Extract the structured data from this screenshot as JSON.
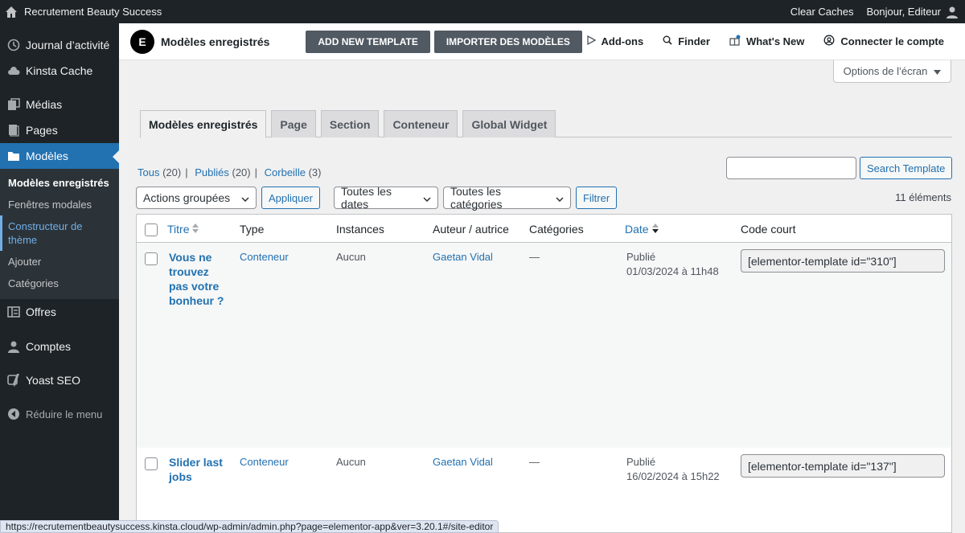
{
  "adminbar": {
    "site_name": "Recrutement Beauty Success",
    "clear_caches": "Clear Caches",
    "greeting": "Bonjour, Editeur"
  },
  "sidebar": {
    "items": [
      {
        "label": "Journal d’activité",
        "icon": "history-icon"
      },
      {
        "label": "Kinsta Cache",
        "icon": "cloud-icon"
      },
      {
        "label": "Médias",
        "icon": "media-icon"
      },
      {
        "label": "Pages",
        "icon": "page-icon"
      },
      {
        "label": "Modèles",
        "icon": "folder-icon"
      },
      {
        "label": "Offres",
        "icon": "offers-icon"
      },
      {
        "label": "Comptes",
        "icon": "user-icon"
      },
      {
        "label": "Yoast SEO",
        "icon": "yoast-icon"
      }
    ],
    "submenu": [
      "Modèles enregistrés",
      "Fenêtres modales",
      "Constructeur de thème",
      "Ajouter",
      "Catégories"
    ],
    "collapse": "Réduire le menu"
  },
  "elementor": {
    "logo": "E",
    "title": "Modèles enregistrés",
    "add_new": "ADD NEW TEMPLATE",
    "import": "IMPORTER DES MODÈLES",
    "links": [
      "Add-ons",
      "Finder",
      "What's New",
      "Connecter le compte"
    ]
  },
  "screen_options": "Options de l’écran",
  "tabs": [
    "Modèles enregistrés",
    "Page",
    "Section",
    "Conteneur",
    "Global Widget"
  ],
  "subsub": {
    "all": "Tous",
    "all_count": "(20)",
    "published": "Publiés",
    "published_count": "(20)",
    "trash": "Corbeille",
    "trash_count": "(3)"
  },
  "search": {
    "button": "Search Template",
    "value": ""
  },
  "filters": {
    "bulk": "Actions groupées",
    "apply": "Appliquer",
    "dates": "Toutes les dates",
    "categories": "Toutes les catégories",
    "filter": "Filtrer"
  },
  "count": "11 éléments",
  "table": {
    "headers": [
      "Titre",
      "Type",
      "Instances",
      "Auteur / autrice",
      "Catégories",
      "Date",
      "Code court"
    ],
    "rows": [
      {
        "title": [
          "Vous ne",
          "trouvez",
          "pas votre",
          "bonheur ?"
        ],
        "type": "Conteneur",
        "instances": "Aucun",
        "author": "Gaetan Vidal",
        "categories": "—",
        "status": "Publié",
        "date": "01/03/2024 à 11h48",
        "shortcode": "[elementor-template id=\"310\"]"
      },
      {
        "title": [
          "Slider last",
          "jobs"
        ],
        "type": "Conteneur",
        "instances": "Aucun",
        "author": "Gaetan Vidal",
        "categories": "—",
        "status": "Publié",
        "date": "16/02/2024 à 15h22",
        "shortcode": "[elementor-template id=\"137\"]"
      }
    ]
  },
  "statusbar": "https://recrutementbeautysuccess.kinsta.cloud/wp-admin/admin.php?page=elementor-app&ver=3.20.1#/site-editor"
}
